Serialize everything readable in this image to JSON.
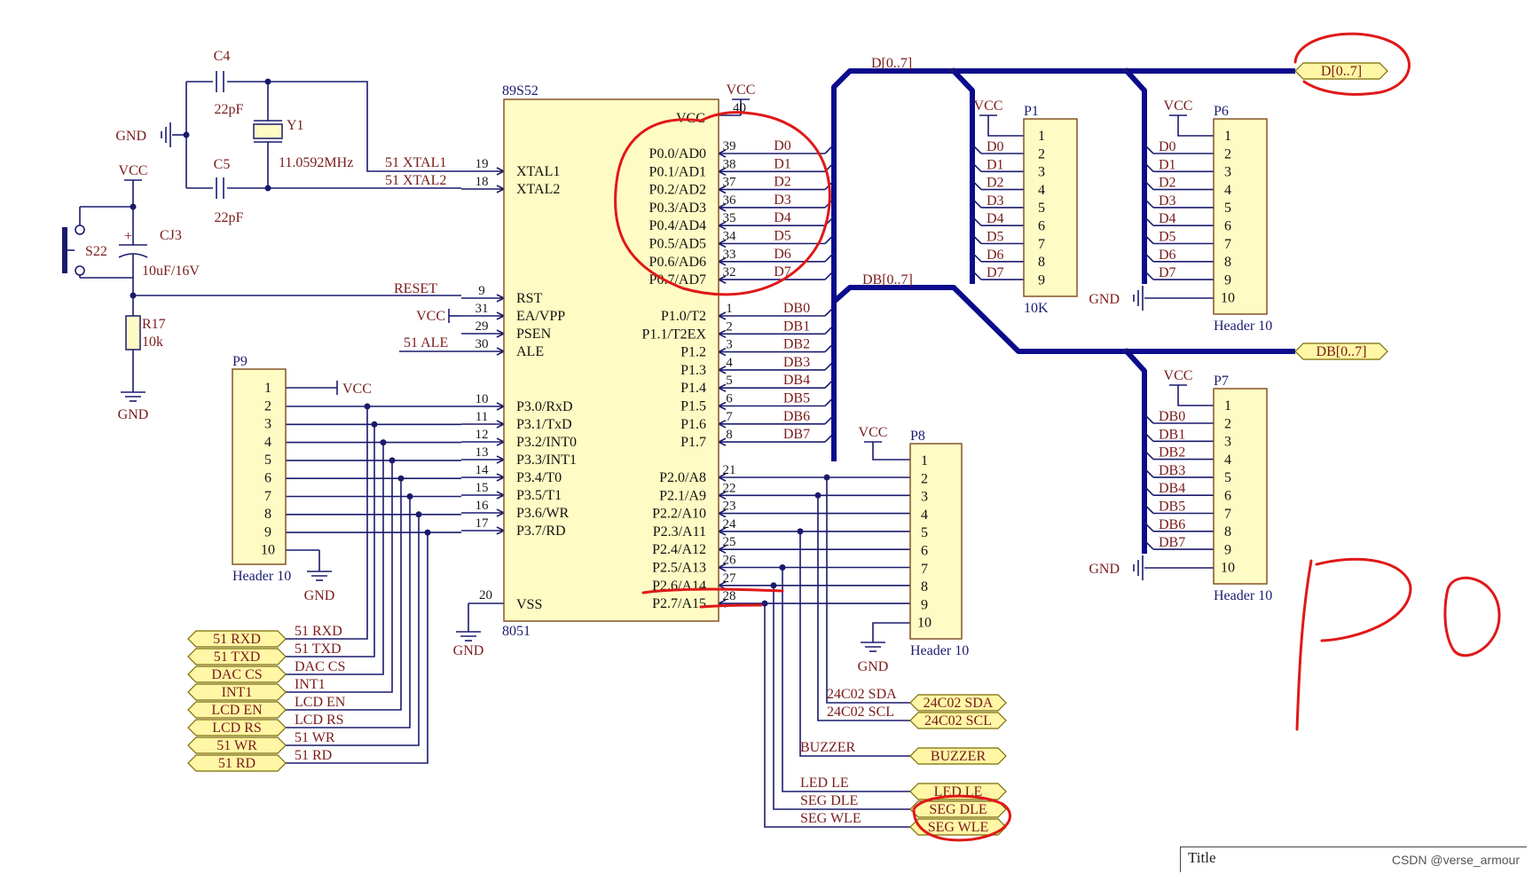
{
  "title_block": {
    "label": "Title",
    "credit": "CSDN @verse_armour"
  },
  "mcu": {
    "top_label": "89S52",
    "bottom_label": "8051",
    "vcc_pin": {
      "num": "40",
      "name": "VCC"
    },
    "vss_pin": {
      "num": "20",
      "name": "VSS"
    },
    "left_pins": [
      {
        "num": "19",
        "name": "XTAL1",
        "net": "51_XTAL1"
      },
      {
        "num": "18",
        "name": "XTAL2",
        "net": "51_XTAL2"
      },
      {
        "num": "9",
        "name": "RST",
        "net": "RESET"
      },
      {
        "num": "31",
        "name": "EA/VPP",
        "net": ""
      },
      {
        "num": "29",
        "name": "PSEN",
        "net": ""
      },
      {
        "num": "30",
        "name": "ALE",
        "net": "51_ALE"
      },
      {
        "num": "10",
        "name": "P3.0/RxD",
        "net": ""
      },
      {
        "num": "11",
        "name": "P3.1/TxD",
        "net": ""
      },
      {
        "num": "12",
        "name": "P3.2/INT0",
        "net": ""
      },
      {
        "num": "13",
        "name": "P3.3/INT1",
        "net": ""
      },
      {
        "num": "14",
        "name": "P3.4/T0",
        "net": ""
      },
      {
        "num": "15",
        "name": "P3.5/T1",
        "net": ""
      },
      {
        "num": "16",
        "name": "P3.6/WR",
        "net": ""
      },
      {
        "num": "17",
        "name": "P3.7/RD",
        "net": ""
      }
    ],
    "port0": [
      {
        "num": "39",
        "name": "P0.0/AD0",
        "net": "D0"
      },
      {
        "num": "38",
        "name": "P0.1/AD1",
        "net": "D1"
      },
      {
        "num": "37",
        "name": "P0.2/AD2",
        "net": "D2"
      },
      {
        "num": "36",
        "name": "P0.3/AD3",
        "net": "D3"
      },
      {
        "num": "35",
        "name": "P0.4/AD4",
        "net": "D4"
      },
      {
        "num": "34",
        "name": "P0.5/AD5",
        "net": "D5"
      },
      {
        "num": "33",
        "name": "P0.6/AD6",
        "net": "D6"
      },
      {
        "num": "32",
        "name": "P0.7/AD7",
        "net": "D7"
      }
    ],
    "port1": [
      {
        "num": "1",
        "name": "P1.0/T2",
        "net": "DB0"
      },
      {
        "num": "2",
        "name": "P1.1/T2EX",
        "net": "DB1"
      },
      {
        "num": "3",
        "name": "P1.2",
        "net": "DB2"
      },
      {
        "num": "4",
        "name": "P1.3",
        "net": "DB3"
      },
      {
        "num": "5",
        "name": "P1.4",
        "net": "DB4"
      },
      {
        "num": "6",
        "name": "P1.5",
        "net": "DB5"
      },
      {
        "num": "7",
        "name": "P1.6",
        "net": "DB6"
      },
      {
        "num": "8",
        "name": "P1.7",
        "net": "DB7"
      }
    ],
    "port2": [
      {
        "num": "21",
        "name": "P2.0/A8"
      },
      {
        "num": "22",
        "name": "P2.1/A9"
      },
      {
        "num": "23",
        "name": "P2.2/A10"
      },
      {
        "num": "24",
        "name": "P2.3/A11"
      },
      {
        "num": "25",
        "name": "P2.4/A12"
      },
      {
        "num": "26",
        "name": "P2.5/A13"
      },
      {
        "num": "27",
        "name": "P2.6/A14"
      },
      {
        "num": "28",
        "name": "P2.7/A15"
      }
    ]
  },
  "osc": {
    "c4": {
      "ref": "C4",
      "value": "22pF"
    },
    "c5": {
      "ref": "C5",
      "value": "22pF"
    },
    "y1": {
      "ref": "Y1",
      "value": "11.0592MHz"
    },
    "gnd": "GND"
  },
  "reset": {
    "vcc": "VCC",
    "switch": "S22",
    "cap": {
      "ref": "CJ3",
      "value": "10uF/16V"
    },
    "res": {
      "ref": "R17",
      "value": "10k"
    },
    "gnd": "GND",
    "ea_vcc": "VCC"
  },
  "p9": {
    "ref": "P9",
    "name": "Header 10",
    "vcc": "VCC",
    "gnd": "GND",
    "pins": [
      "1",
      "2",
      "3",
      "4",
      "5",
      "6",
      "7",
      "8",
      "9",
      "10"
    ],
    "nets": [
      {
        "wire": "51_RXD",
        "port": "51_RXD"
      },
      {
        "wire": "51_TXD",
        "port": "51_TXD"
      },
      {
        "wire": "DAC_CS",
        "port": "DAC_CS"
      },
      {
        "wire": "INT1",
        "port": "INT1"
      },
      {
        "wire": "LCD_EN",
        "port": "LCD_EN"
      },
      {
        "wire": "LCD_RS",
        "port": "LCD_RS"
      },
      {
        "wire": "51_WR",
        "port": "51_WR"
      },
      {
        "wire": "51_RD",
        "port": "51_RD"
      }
    ]
  },
  "vss_gnd": "GND",
  "p8": {
    "ref": "P8",
    "name": "Header 10",
    "vcc": "VCC",
    "gnd": "GND",
    "pins": [
      "1",
      "2",
      "3",
      "4",
      "5",
      "6",
      "7",
      "8",
      "9",
      "10"
    ]
  },
  "p2_nets": [
    {
      "wire": "24C02_SDA",
      "port": "24C02_SDA"
    },
    {
      "wire": "24C02_SCL",
      "port": "24C02_SCL"
    },
    {
      "wire": "BUZZER",
      "port": "BUZZER"
    },
    {
      "wire": "LED_LE",
      "port": "LED_LE"
    },
    {
      "wire": "SEG_DLE",
      "port": "SEG_DLE"
    },
    {
      "wire": "SEG_WLE",
      "port": "SEG_WLE"
    }
  ],
  "buses": {
    "d_bus": "D[0..7]",
    "d_port": "D[0..7]",
    "db_bus": "DB[0..7]",
    "db_port": "DB[0..7]"
  },
  "p1": {
    "ref": "P1",
    "name": "10K",
    "vcc": "VCC",
    "pins": [
      "1",
      "2",
      "3",
      "4",
      "5",
      "6",
      "7",
      "8",
      "9"
    ],
    "nets": [
      "D0",
      "D1",
      "D2",
      "D3",
      "D4",
      "D5",
      "D6",
      "D7"
    ]
  },
  "p6": {
    "ref": "P6",
    "name": "Header 10",
    "vcc": "VCC",
    "gnd": "GND",
    "pins": [
      "1",
      "2",
      "3",
      "4",
      "5",
      "6",
      "7",
      "8",
      "9",
      "10"
    ],
    "nets": [
      "D0",
      "D1",
      "D2",
      "D3",
      "D4",
      "D5",
      "D6",
      "D7"
    ]
  },
  "p7": {
    "ref": "P7",
    "name": "Header 10",
    "vcc": "VCC",
    "gnd": "GND",
    "pins": [
      "1",
      "2",
      "3",
      "4",
      "5",
      "6",
      "7",
      "8",
      "9",
      "10"
    ],
    "nets": [
      "DB0",
      "DB1",
      "DB2",
      "DB3",
      "DB4",
      "DB5",
      "DB6",
      "DB7"
    ]
  },
  "annotation": {
    "handwritten": "P0"
  },
  "colors": {
    "bus": "#0b0b8c",
    "wire": "#1a1a6e",
    "ink": "#e01818",
    "part": "#fffbc4",
    "net_port": "#fff6a6"
  }
}
